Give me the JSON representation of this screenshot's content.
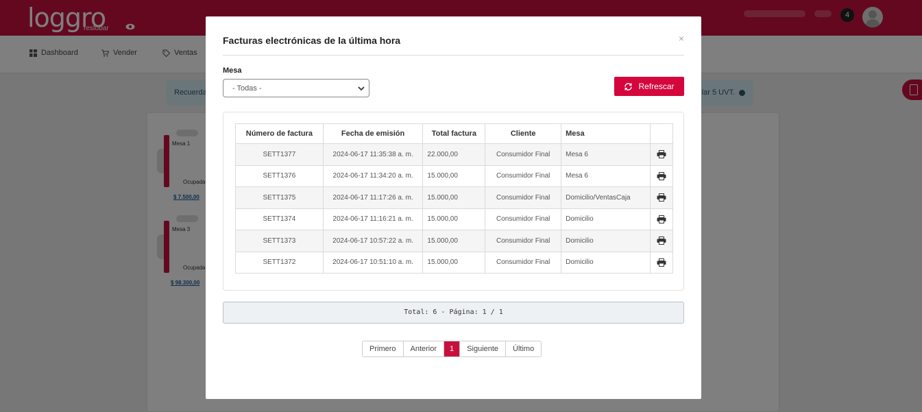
{
  "app": {
    "logo_text": "loggro",
    "logo_sub": "restobar",
    "notifications_count": "4"
  },
  "nav": {
    "items": [
      {
        "label": "Dashboard",
        "icon": "grid-icon"
      },
      {
        "label": "Vender",
        "icon": "cart-icon"
      },
      {
        "label": "Ventas",
        "icon": "tag-icon"
      }
    ]
  },
  "banner": {
    "left_text": "Recuerda",
    "right_text": "lar 5 UVT."
  },
  "tables": [
    {
      "name": "Mesa 1",
      "status": "Ocupada",
      "amount": "$ 7.500,00"
    },
    {
      "name": "Mesa 3",
      "status": "Ocupada",
      "amount": "$ 98.300,00"
    }
  ],
  "modal": {
    "title": "Facturas electrónicas de la última hora",
    "close": "×",
    "filter_label": "Mesa",
    "filter_value": "- Todas -",
    "refresh_label": "Refrescar",
    "columns": [
      "Número de factura",
      "Fecha de emisión",
      "Total factura",
      "Cliente",
      "Mesa",
      ""
    ],
    "rows": [
      {
        "numero": "SETT1377",
        "fecha": "2024-06-17 11:35:38 a. m.",
        "total": "22.000,00",
        "cliente": "Consumidor Final",
        "mesa": "Mesa 6"
      },
      {
        "numero": "SETT1376",
        "fecha": "2024-06-17 11:34:20 a. m.",
        "total": "15.000,00",
        "cliente": "Consumidor Final",
        "mesa": "Mesa 6"
      },
      {
        "numero": "SETT1375",
        "fecha": "2024-06-17 11:17:26 a. m.",
        "total": "15.000,00",
        "cliente": "Consumidor Final",
        "mesa": "Domicilio/VentasCaja"
      },
      {
        "numero": "SETT1374",
        "fecha": "2024-06-17 11:16:21 a. m.",
        "total": "15.000,00",
        "cliente": "Consumidor Final",
        "mesa": "Domicilio"
      },
      {
        "numero": "SETT1373",
        "fecha": "2024-06-17 10:57:22 a. m.",
        "total": "15.000,00",
        "cliente": "Consumidor Final",
        "mesa": "Domicilio"
      },
      {
        "numero": "SETT1372",
        "fecha": "2024-06-17 10:51:10 a. m.",
        "total": "15.000,00",
        "cliente": "Consumidor Final",
        "mesa": "Domicilio"
      }
    ],
    "summary": "Total: 6 - Página: 1 / 1",
    "pagination": {
      "first": "Primero",
      "prev": "Anterior",
      "current": "1",
      "next": "Siguiente",
      "last": "Último"
    }
  },
  "colors": {
    "brand": "#c8103e",
    "button": "#d4063c"
  }
}
